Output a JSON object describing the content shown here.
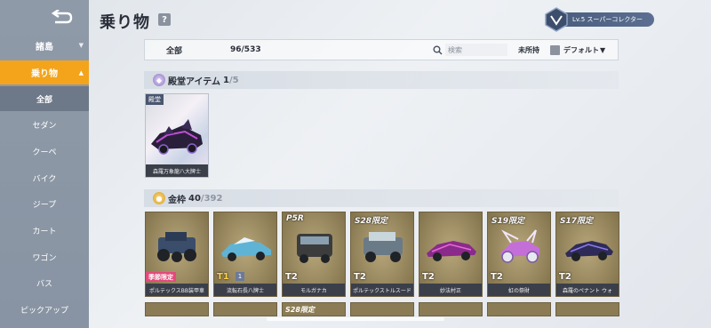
{
  "header": {
    "title": "乗り物",
    "rank_label": "Lv.5 スーパーコレクター"
  },
  "sidebar": {
    "sort_label": "諸島",
    "active_category": "乗り物",
    "active_sub": "全部",
    "items": [
      "セダン",
      "クーペ",
      "バイク",
      "ジープ",
      "カート",
      "ワゴン",
      "バス",
      "ピックアップ"
    ]
  },
  "filter": {
    "label": "全部",
    "count": "96/533",
    "search_placeholder": "検索",
    "unowned_label": "未所持",
    "default_label": "デフォルト"
  },
  "hall_section": {
    "title": "殿堂アイテム",
    "count_owned": "1",
    "count_total": "/5",
    "card": {
      "tag": "殿堂",
      "name": "森羅万象龍八大牌士"
    }
  },
  "gold_section": {
    "title": "金枠",
    "count_owned": "40",
    "count_total": "/392",
    "cards": [
      {
        "limited": "",
        "tier": "",
        "ribbon": "季節限定",
        "name": "ポルテックスBB装甲車",
        "color": "#3a4d6b"
      },
      {
        "limited": "",
        "tier": "T1",
        "ribbon": "",
        "name": "流転石長八牌士",
        "color": "#5fb4d6"
      },
      {
        "limited": "P5R",
        "tier": "T2",
        "ribbon": "",
        "name": "モルガナカ",
        "color": "#3c3c3c"
      },
      {
        "limited": "S28限定",
        "tier": "T2",
        "ribbon": "",
        "name": "ポルテックストルスード",
        "color": "#6a7a86"
      },
      {
        "limited": "",
        "tier": "T2",
        "ribbon": "",
        "name": "妙法村正",
        "color": "#8a2a8a"
      },
      {
        "limited": "S19限定",
        "tier": "T2",
        "ribbon": "",
        "name": "虹の祭財",
        "color": "#c46fd8"
      },
      {
        "limited": "S17限定",
        "tier": "T2",
        "ribbon": "",
        "name": "森羅のペナント ウォ",
        "color": "#6a5cc8"
      }
    ],
    "next_row_label": "S28限定"
  },
  "colors": {
    "accent": "#f3a41b",
    "sidebar": "#8f9aa8",
    "gold_frame": "#8f7f57"
  },
  "icons": [
    "back-icon",
    "help-icon",
    "rank-emblem-icon",
    "search-icon",
    "hall-icon",
    "gold-icon"
  ]
}
